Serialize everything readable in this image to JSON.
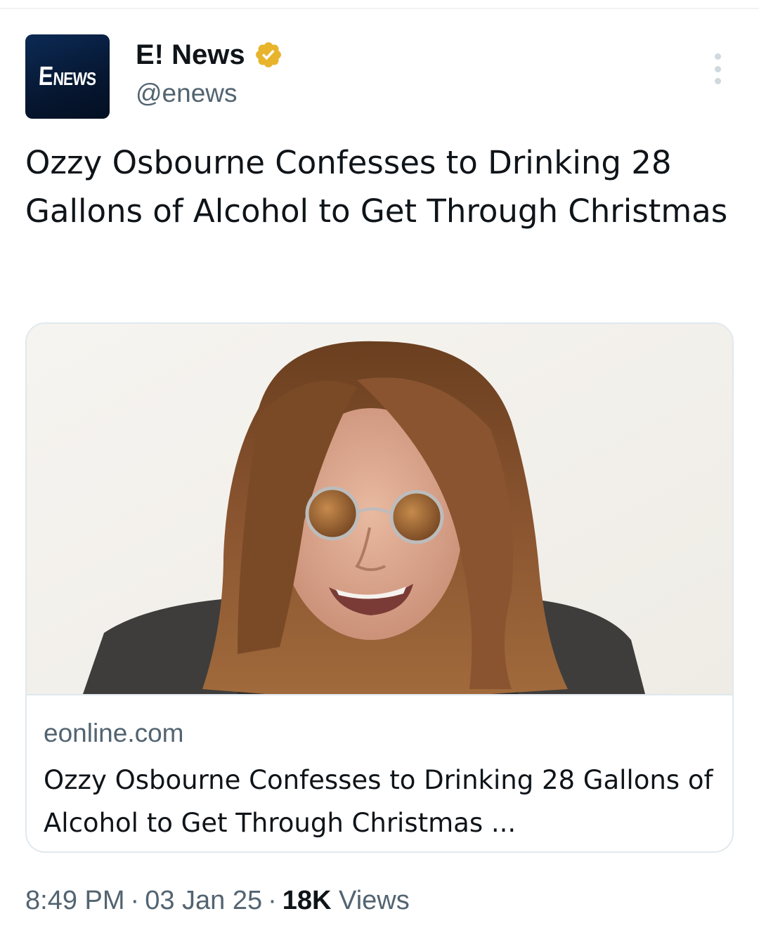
{
  "tweet": {
    "author": {
      "display_name": "E! News",
      "handle": "@enews",
      "avatar_text_big": "E",
      "avatar_text_small": "NEWS",
      "verified_badge": "verified-gold-badge-icon",
      "verified_color": "#e8b42c"
    },
    "more_icon": "more-vertical-icon",
    "text": "Ozzy Osbourne Confesses to Drinking 28 Gallons of Alcohol to Get Through Christmas",
    "card": {
      "image_description": "portrait-photo",
      "domain": "eonline.com",
      "title": "Ozzy Osbourne Confesses to Drinking 28 Gallons of Alcohol to Get Through Christmas ..."
    },
    "meta": {
      "time": "8:49 PM",
      "separator": "·",
      "date": "03 Jan 25",
      "views_count": "18K",
      "views_label": "Views"
    }
  },
  "colors": {
    "primary_text": "#0f1419",
    "secondary_text": "#536471",
    "border": "#e1e8ed",
    "avatar_bg": "#061731"
  }
}
